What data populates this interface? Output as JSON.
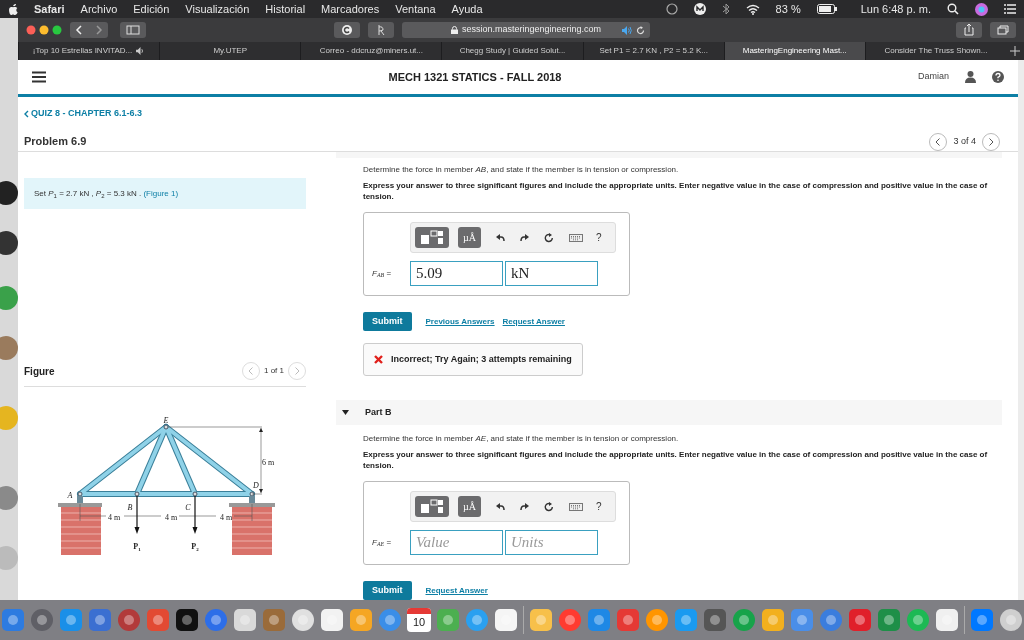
{
  "menu_bar": {
    "app": "Safari",
    "menus": [
      "Archivo",
      "Edición",
      "Visualización",
      "Historial",
      "Marcadores",
      "Ventana",
      "Ayuda"
    ],
    "battery": "83 %",
    "clock": "Lun 6:48 p. m."
  },
  "browser": {
    "address": "session.masteringengineering.com",
    "tabs": [
      {
        "label": "¡Top 10 Estrellas INVITAD...",
        "selected": false,
        "audio": true
      },
      {
        "label": "My.UTEP",
        "selected": false,
        "audio": false
      },
      {
        "label": "Correo - ddcruz@miners.ut...",
        "selected": false,
        "audio": false
      },
      {
        "label": "Chegg Study | Guided Solut...",
        "selected": false,
        "audio": false
      },
      {
        "label": "Set P1 = 2.7 KN , P2 = 5.2 K...",
        "selected": false,
        "audio": false
      },
      {
        "label": "MasteringEngineering Mast...",
        "selected": true,
        "audio": false
      },
      {
        "label": "Consider The Truss Shown...",
        "selected": false,
        "audio": false
      }
    ]
  },
  "header": {
    "title": "MECH 1321 STATICS - FALL 2018",
    "user": "Damian"
  },
  "breadcrumb": "QUIZ 8 - CHAPTER 6.1-6.3",
  "problem": {
    "title": "Problem 6.9",
    "position": "3 of 4",
    "statement": "Set *P*$_{1}$ = 2.7 kN , *P*$_{2}$ = 5.3 kN . ",
    "figure_link": "(Figure 1)"
  },
  "figure": {
    "heading": "Figure",
    "position": "1 of 1",
    "labels": [
      "E",
      "A",
      "B",
      "C",
      "D",
      "6 m",
      "4 m",
      "4 m",
      "4 m",
      "P$_{1}$",
      "P$_{2}$"
    ]
  },
  "parts": [
    {
      "question": "Determine the force in member *AB*, and state if the member is in tension or compression.",
      "instructions": "Express your answer to three significant figures and include the appropriate units. Enter negative value in the case of compression and positive value in the case of tension.",
      "units_button": "µÅ",
      "help": "?",
      "variable": "*F*$_{AB}$ =",
      "value": "5.09",
      "units": "kN",
      "submit": "Submit",
      "links": [
        "Previous Answers",
        "Request Answer"
      ],
      "feedback": "Incorrect; Try Again; 3 attempts remaining"
    },
    {
      "title": "Part B",
      "expanded": true,
      "question": "Determine the force in member *AE*, and state if the member is in tension or compression.",
      "instructions": "Express your answer to three significant figures and include the appropriate units. Enter negative value in the case of compression and positive value in the case of tension.",
      "units_button": "µÅ",
      "help": "?",
      "variable": "*F*$_{AE}$ =",
      "value_placeholder": "Value",
      "units_placeholder": "Units",
      "submit": "Submit",
      "links": [
        "Request Answer"
      ]
    }
  ],
  "dock": {
    "calendar_day": "10"
  }
}
